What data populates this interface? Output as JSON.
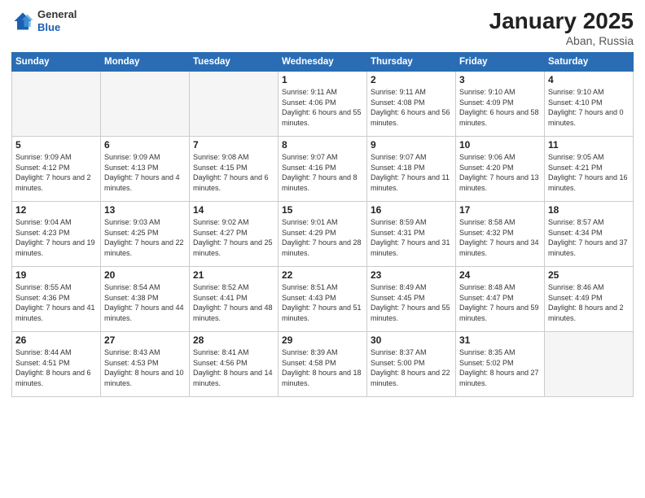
{
  "logo": {
    "general": "General",
    "blue": "Blue"
  },
  "header": {
    "month": "January 2025",
    "location": "Aban, Russia"
  },
  "weekdays": [
    "Sunday",
    "Monday",
    "Tuesday",
    "Wednesday",
    "Thursday",
    "Friday",
    "Saturday"
  ],
  "weeks": [
    [
      {
        "day": "",
        "sunrise": "",
        "sunset": "",
        "daylight": "",
        "empty": true
      },
      {
        "day": "",
        "sunrise": "",
        "sunset": "",
        "daylight": "",
        "empty": true
      },
      {
        "day": "",
        "sunrise": "",
        "sunset": "",
        "daylight": "",
        "empty": true
      },
      {
        "day": "1",
        "sunrise": "Sunrise: 9:11 AM",
        "sunset": "Sunset: 4:06 PM",
        "daylight": "Daylight: 6 hours and 55 minutes."
      },
      {
        "day": "2",
        "sunrise": "Sunrise: 9:11 AM",
        "sunset": "Sunset: 4:08 PM",
        "daylight": "Daylight: 6 hours and 56 minutes."
      },
      {
        "day": "3",
        "sunrise": "Sunrise: 9:10 AM",
        "sunset": "Sunset: 4:09 PM",
        "daylight": "Daylight: 6 hours and 58 minutes."
      },
      {
        "day": "4",
        "sunrise": "Sunrise: 9:10 AM",
        "sunset": "Sunset: 4:10 PM",
        "daylight": "Daylight: 7 hours and 0 minutes."
      }
    ],
    [
      {
        "day": "5",
        "sunrise": "Sunrise: 9:09 AM",
        "sunset": "Sunset: 4:12 PM",
        "daylight": "Daylight: 7 hours and 2 minutes."
      },
      {
        "day": "6",
        "sunrise": "Sunrise: 9:09 AM",
        "sunset": "Sunset: 4:13 PM",
        "daylight": "Daylight: 7 hours and 4 minutes."
      },
      {
        "day": "7",
        "sunrise": "Sunrise: 9:08 AM",
        "sunset": "Sunset: 4:15 PM",
        "daylight": "Daylight: 7 hours and 6 minutes."
      },
      {
        "day": "8",
        "sunrise": "Sunrise: 9:07 AM",
        "sunset": "Sunset: 4:16 PM",
        "daylight": "Daylight: 7 hours and 8 minutes."
      },
      {
        "day": "9",
        "sunrise": "Sunrise: 9:07 AM",
        "sunset": "Sunset: 4:18 PM",
        "daylight": "Daylight: 7 hours and 11 minutes."
      },
      {
        "day": "10",
        "sunrise": "Sunrise: 9:06 AM",
        "sunset": "Sunset: 4:20 PM",
        "daylight": "Daylight: 7 hours and 13 minutes."
      },
      {
        "day": "11",
        "sunrise": "Sunrise: 9:05 AM",
        "sunset": "Sunset: 4:21 PM",
        "daylight": "Daylight: 7 hours and 16 minutes."
      }
    ],
    [
      {
        "day": "12",
        "sunrise": "Sunrise: 9:04 AM",
        "sunset": "Sunset: 4:23 PM",
        "daylight": "Daylight: 7 hours and 19 minutes."
      },
      {
        "day": "13",
        "sunrise": "Sunrise: 9:03 AM",
        "sunset": "Sunset: 4:25 PM",
        "daylight": "Daylight: 7 hours and 22 minutes."
      },
      {
        "day": "14",
        "sunrise": "Sunrise: 9:02 AM",
        "sunset": "Sunset: 4:27 PM",
        "daylight": "Daylight: 7 hours and 25 minutes."
      },
      {
        "day": "15",
        "sunrise": "Sunrise: 9:01 AM",
        "sunset": "Sunset: 4:29 PM",
        "daylight": "Daylight: 7 hours and 28 minutes."
      },
      {
        "day": "16",
        "sunrise": "Sunrise: 8:59 AM",
        "sunset": "Sunset: 4:31 PM",
        "daylight": "Daylight: 7 hours and 31 minutes."
      },
      {
        "day": "17",
        "sunrise": "Sunrise: 8:58 AM",
        "sunset": "Sunset: 4:32 PM",
        "daylight": "Daylight: 7 hours and 34 minutes."
      },
      {
        "day": "18",
        "sunrise": "Sunrise: 8:57 AM",
        "sunset": "Sunset: 4:34 PM",
        "daylight": "Daylight: 7 hours and 37 minutes."
      }
    ],
    [
      {
        "day": "19",
        "sunrise": "Sunrise: 8:55 AM",
        "sunset": "Sunset: 4:36 PM",
        "daylight": "Daylight: 7 hours and 41 minutes."
      },
      {
        "day": "20",
        "sunrise": "Sunrise: 8:54 AM",
        "sunset": "Sunset: 4:38 PM",
        "daylight": "Daylight: 7 hours and 44 minutes."
      },
      {
        "day": "21",
        "sunrise": "Sunrise: 8:52 AM",
        "sunset": "Sunset: 4:41 PM",
        "daylight": "Daylight: 7 hours and 48 minutes."
      },
      {
        "day": "22",
        "sunrise": "Sunrise: 8:51 AM",
        "sunset": "Sunset: 4:43 PM",
        "daylight": "Daylight: 7 hours and 51 minutes."
      },
      {
        "day": "23",
        "sunrise": "Sunrise: 8:49 AM",
        "sunset": "Sunset: 4:45 PM",
        "daylight": "Daylight: 7 hours and 55 minutes."
      },
      {
        "day": "24",
        "sunrise": "Sunrise: 8:48 AM",
        "sunset": "Sunset: 4:47 PM",
        "daylight": "Daylight: 7 hours and 59 minutes."
      },
      {
        "day": "25",
        "sunrise": "Sunrise: 8:46 AM",
        "sunset": "Sunset: 4:49 PM",
        "daylight": "Daylight: 8 hours and 2 minutes."
      }
    ],
    [
      {
        "day": "26",
        "sunrise": "Sunrise: 8:44 AM",
        "sunset": "Sunset: 4:51 PM",
        "daylight": "Daylight: 8 hours and 6 minutes."
      },
      {
        "day": "27",
        "sunrise": "Sunrise: 8:43 AM",
        "sunset": "Sunset: 4:53 PM",
        "daylight": "Daylight: 8 hours and 10 minutes."
      },
      {
        "day": "28",
        "sunrise": "Sunrise: 8:41 AM",
        "sunset": "Sunset: 4:56 PM",
        "daylight": "Daylight: 8 hours and 14 minutes."
      },
      {
        "day": "29",
        "sunrise": "Sunrise: 8:39 AM",
        "sunset": "Sunset: 4:58 PM",
        "daylight": "Daylight: 8 hours and 18 minutes."
      },
      {
        "day": "30",
        "sunrise": "Sunrise: 8:37 AM",
        "sunset": "Sunset: 5:00 PM",
        "daylight": "Daylight: 8 hours and 22 minutes."
      },
      {
        "day": "31",
        "sunrise": "Sunrise: 8:35 AM",
        "sunset": "Sunset: 5:02 PM",
        "daylight": "Daylight: 8 hours and 27 minutes."
      },
      {
        "day": "",
        "sunrise": "",
        "sunset": "",
        "daylight": "",
        "empty": true
      }
    ]
  ]
}
